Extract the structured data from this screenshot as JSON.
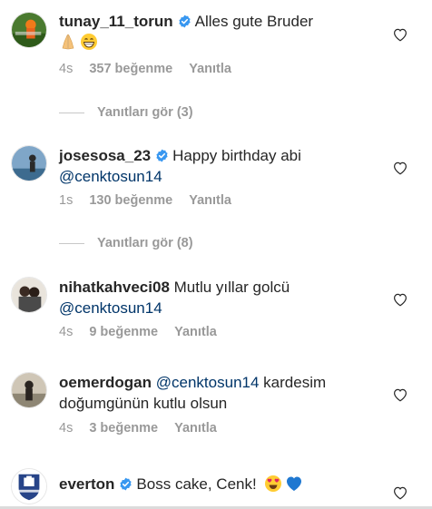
{
  "comments": [
    {
      "username": "tunay_11_torun",
      "verified": true,
      "text": "Alles gute Bruder",
      "emojis": [
        "folded-hands-emoji",
        "grinning-face-emoji"
      ],
      "time": "4s",
      "likes": "357 beğenme",
      "reply": "Yanıtla",
      "view_replies": "Yanıtları gör (3)"
    },
    {
      "username": "josesosa_23",
      "verified": true,
      "text": "Happy birthday abi",
      "mention": "@cenktosun14",
      "time": "1s",
      "likes": "130 beğenme",
      "reply": "Yanıtla",
      "view_replies": "Yanıtları gör (8)"
    },
    {
      "username": "nihatkahveci08",
      "verified": false,
      "text": "Mutlu yıllar golcü",
      "mention": "@cenktosun14",
      "time": "4s",
      "likes": "9 beğenme",
      "reply": "Yanıtla"
    },
    {
      "username": "oemerdogan",
      "verified": false,
      "mention": "@cenktosun14",
      "text": "kardesim doğumgünün kutlu olsun",
      "time": "4s",
      "likes": "3 beğenme",
      "reply": "Yanıtla"
    },
    {
      "username": "everton",
      "verified": true,
      "text": "Boss cake, Cenk!",
      "emojis": [
        "heart-eyes-emoji",
        "blue-heart-emoji"
      ]
    }
  ],
  "colors": {
    "username": "#262626",
    "mention": "#003569",
    "meta": "#999999",
    "verified": "#3897f0"
  },
  "icons": {
    "like": "heart-outline-icon",
    "verified": "verified-badge-icon"
  }
}
